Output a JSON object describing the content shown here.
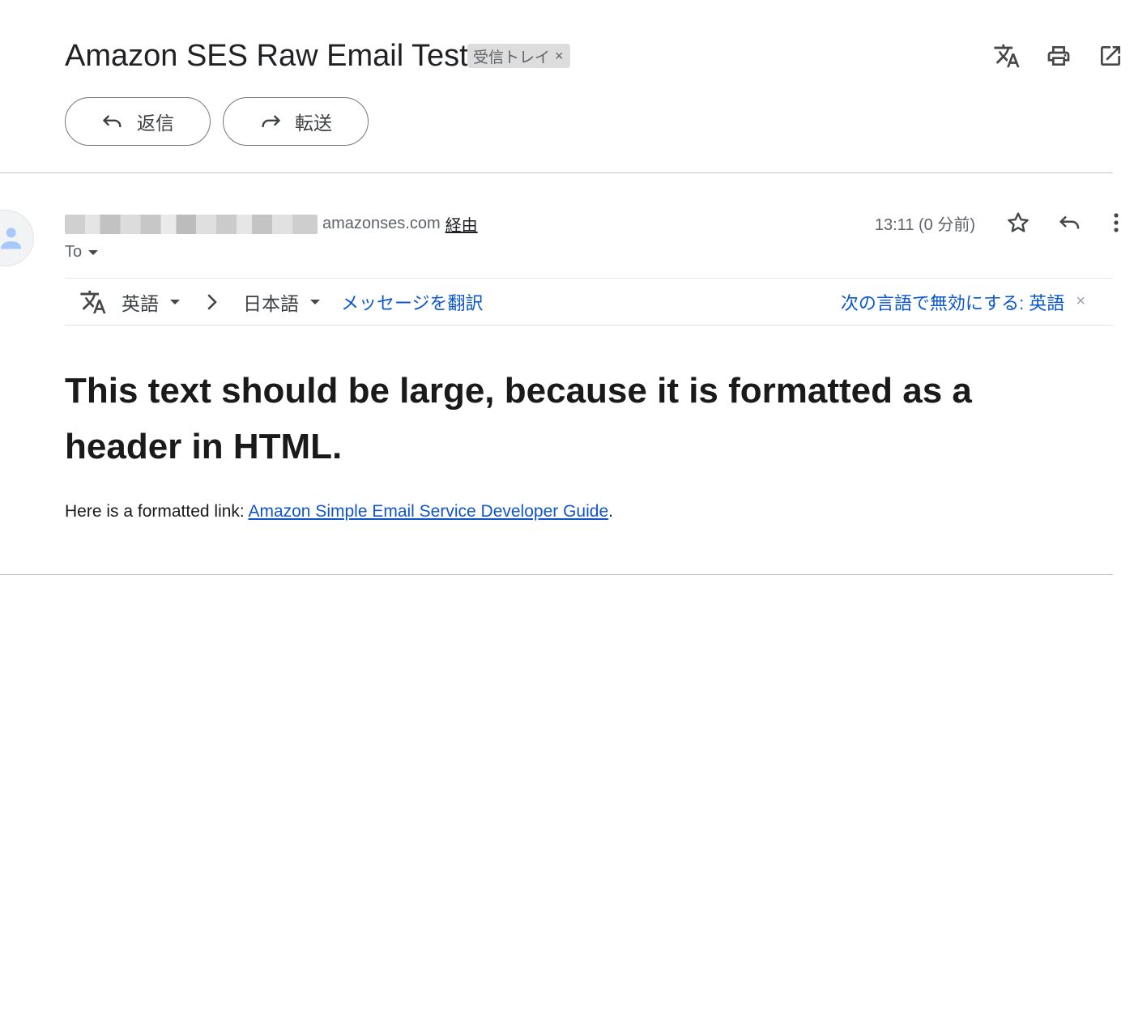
{
  "email": {
    "subject": "Amazon SES Raw Email Test",
    "label_chip": "受信トレイ",
    "label_chip_close": "×"
  },
  "header_icons": [
    "translate-icon",
    "print-icon",
    "open-in-new-window-icon"
  ],
  "actions": {
    "reply_label": "返信",
    "forward_label": "転送"
  },
  "sender": {
    "domain": "amazonses.com",
    "via_label": "経由",
    "to_label": "To",
    "timestamp": "13:11 (0 分前)"
  },
  "translation_bar": {
    "source_language": "英語",
    "target_language": "日本語",
    "translate_link": "メッセージを翻訳",
    "disable_link": "次の言語で無効にする: 英語",
    "close": "×"
  },
  "body": {
    "heading": "This text should be large, because it is formatted as a header in HTML.",
    "paragraph_prefix": "Here is a formatted link: ",
    "link_text": "Amazon Simple Email Service Developer Guide",
    "paragraph_suffix": "."
  },
  "colors": {
    "link_blue": "#1155cc",
    "accent_blue": "#0b57d0",
    "text_primary": "#202124",
    "text_secondary": "#5f6368"
  }
}
